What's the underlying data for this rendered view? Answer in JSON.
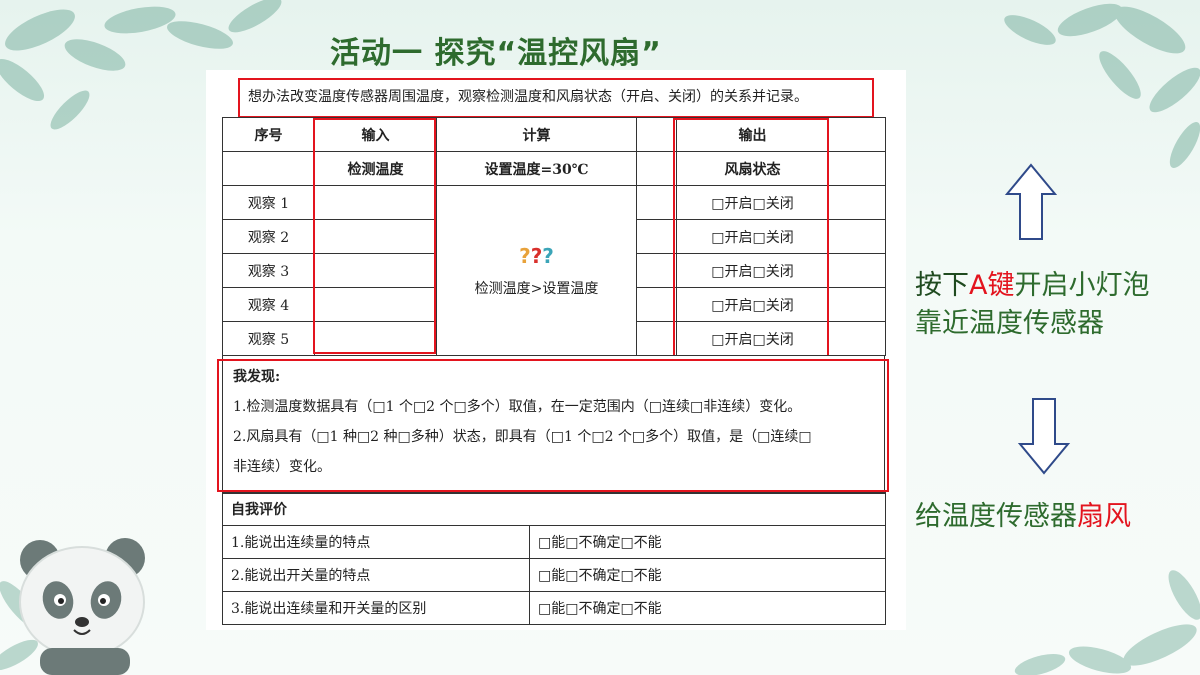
{
  "title": "活动一  探究“温控风扇”",
  "instruction": "想办法改变温度传感器周围温度，观察检测温度和风扇状态（开启、关闭）的关系并记录。",
  "table": {
    "headers": {
      "index": "序号",
      "input": "输入",
      "calc": "计算",
      "output": "输出",
      "input_sub": "检测温度",
      "calc_sub": "设置温度=30℃",
      "output_sub": "风扇状态"
    },
    "calc_icon": [
      "?",
      "?",
      "?"
    ],
    "calc_note": "检测温度>设置温度",
    "rows": [
      {
        "label": "观察 1",
        "status": "□开启□关闭"
      },
      {
        "label": "观察 2",
        "status": "□开启□关闭"
      },
      {
        "label": "观察 3",
        "status": "□开启□关闭"
      },
      {
        "label": "观察 4",
        "status": "□开启□关闭"
      },
      {
        "label": "观察 5",
        "status": "□开启□关闭"
      }
    ]
  },
  "findings": {
    "heading": "我发现:",
    "line1": "1.检测温度数据具有（□1 个□2 个□多个）取值，在一定范围内（□连续□非连续）变化。",
    "line2": "2.风扇具有（□1 种□2 种□多种）状态，即具有（□1 个□2 个□多个）取值，是（□连续□",
    "line3": "非连续）变化。"
  },
  "self_eval": {
    "heading": "自我评价",
    "items": [
      {
        "text": "1.能说出连续量的特点",
        "options": "□能□不确定□不能"
      },
      {
        "text": "2.能说出开关量的特点",
        "options": "□能□不确定□不能"
      },
      {
        "text": "3.能说出连续量和开关量的区别",
        "options": "□能□不确定□不能"
      }
    ]
  },
  "side": {
    "line1_a": "按下",
    "line1_b": "A键",
    "line1_c": "开启小灯泡",
    "line2": "靠近温度传感器",
    "line3_a": "给温度传感器",
    "line3_b": "扇风"
  },
  "colors": {
    "accent_green": "#2e6b2e",
    "highlight_red": "#e3141e",
    "arrow_blue": "#2f4a8a"
  },
  "icons": [
    "arrow-up-icon",
    "arrow-down-icon",
    "question-marks-icon",
    "panda-illustration",
    "leaf-decoration"
  ]
}
